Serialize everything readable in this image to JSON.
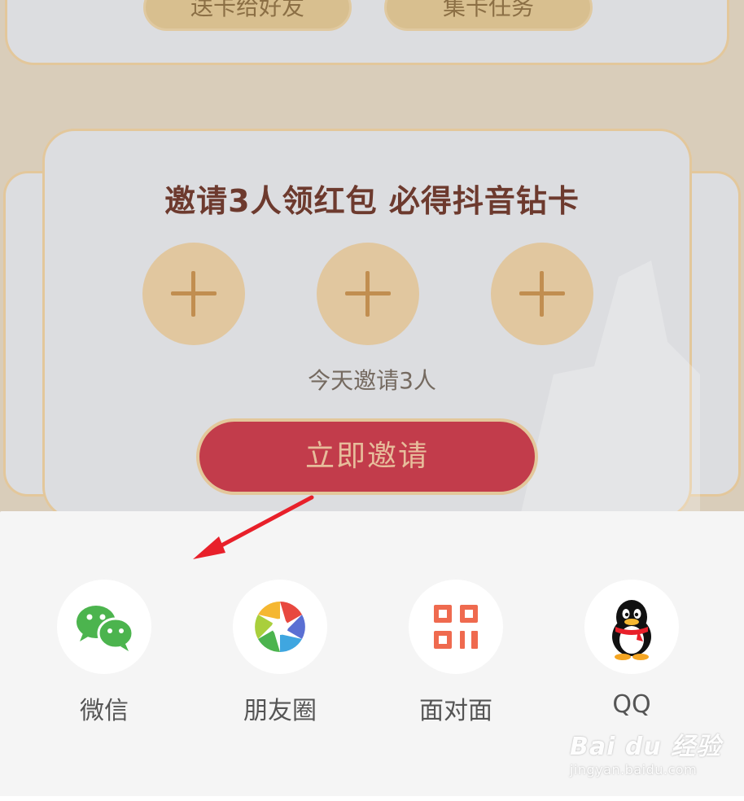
{
  "background_page": {
    "top_buttons": [
      "送卡给好友",
      "集卡任务"
    ],
    "invite_title": "邀请3人领红包 必得抖音钻卡",
    "invite_subtitle": "今天邀请3人",
    "invite_button": "立即邀请"
  },
  "share_sheet": {
    "items": [
      {
        "label": "微信",
        "icon": "wechat-icon"
      },
      {
        "label": "朋友圈",
        "icon": "moments-icon"
      },
      {
        "label": "面对面",
        "icon": "qr-code-icon"
      },
      {
        "label": "QQ",
        "icon": "qq-icon"
      }
    ]
  },
  "watermark": {
    "main": "Bai du 经验",
    "sub": "jingyan.baidu.com"
  },
  "colors": {
    "overlay_bg": "#d9cdba",
    "invite_button": "#c23c4b",
    "accent_gold": "#e3c79b",
    "arrow": "#e8202a",
    "sheet_bg": "#f5f5f5"
  }
}
